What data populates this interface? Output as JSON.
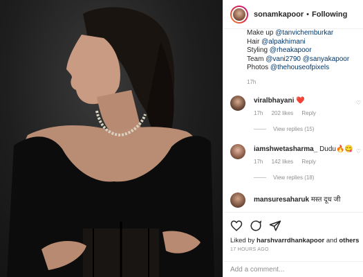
{
  "header": {
    "username": "sonamkapoor",
    "separator": "•",
    "follow_label": "Following"
  },
  "caption": {
    "lines": [
      {
        "prefix": "Make up ",
        "mention": "@tanvichemburkar"
      },
      {
        "prefix": "Hair ",
        "mention": "@alpakhimani"
      },
      {
        "prefix": "Styling ",
        "mention": "@rheakapoor"
      },
      {
        "prefix": "Team ",
        "mention": "@vani2790",
        "mention2": "@sanyakapoor"
      },
      {
        "prefix": "Photos ",
        "mention": "@thehouseofpixels"
      }
    ],
    "time": "17h"
  },
  "comments": [
    {
      "user": "viralbhayani",
      "text": "❤️",
      "time": "17h",
      "likes": "202 likes",
      "reply": "Reply",
      "view_replies": "View replies (15)"
    },
    {
      "user": "iamshwetasharma_",
      "text": "Dudu🔥😋",
      "time": "17h",
      "likes": "142 likes",
      "reply": "Reply",
      "view_replies": "View replies (18)"
    },
    {
      "user": "mansuresaharuk",
      "text": "मस्त दूध जी",
      "time": "",
      "likes": "",
      "reply": "",
      "view_replies": ""
    }
  ],
  "actions": {
    "liked_by_prefix": "Liked by ",
    "liked_by_user": "harshvarrdhankapoor",
    "liked_by_suffix": " and ",
    "liked_by_others": "others",
    "time_ago": "17 HOURS AGO",
    "add_comment_placeholder": "Add a comment..."
  },
  "colors": {
    "link": "#00376b",
    "muted": "#8e8e8e",
    "text": "#262626",
    "heart": "#ed4956"
  }
}
